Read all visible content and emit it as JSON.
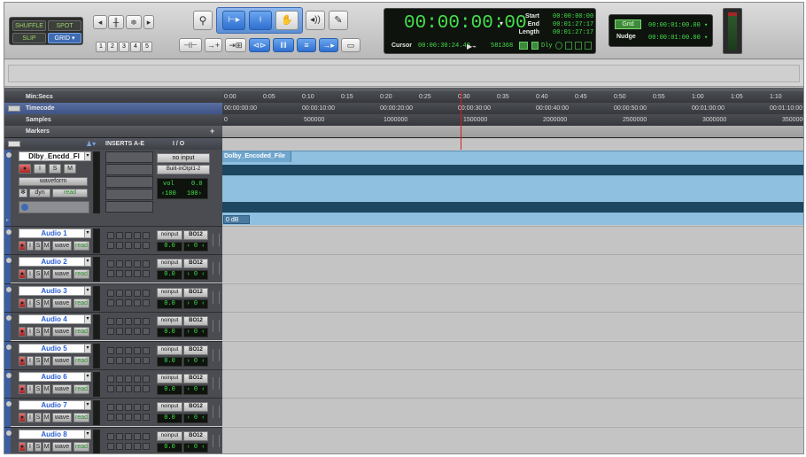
{
  "colors": {
    "accent": "#3f6bb2",
    "counter_green": "#45e04a",
    "track_name": "#2a5fd2",
    "clip_fill": "#8fc0df",
    "clip_dark": "#1d4660",
    "ruler": "#3a3c41",
    "playhead": "#d02020"
  },
  "modes": {
    "shuffle": "SHUFFLE",
    "spot": "SPOT",
    "slip": "SLIP",
    "grid": "GRID ▾"
  },
  "zoom_presets": [
    "1",
    "2",
    "3",
    "4",
    "5"
  ],
  "tool_icons": [
    "zoomer-icon",
    "trim-icon",
    "selector-icon",
    "grabber-icon",
    "scrub-icon",
    "pencil-icon"
  ],
  "counters": {
    "main": "00:00:00:00",
    "main_arrow": "▾",
    "start_label": "Start",
    "end_label": "End",
    "length_label": "Length",
    "start": "00:00:00:00",
    "end": "00:01:27:17",
    "length": "00:01:27:17",
    "cursor_label": "Cursor",
    "cursor": "00:00:30:24.40",
    "sample_count": "581368",
    "dly": "Dly"
  },
  "grid": {
    "grid_label": "Grid",
    "grid_value": "00:00:01:00.00 ▾",
    "nudge_label": "Nudge",
    "nudge_value": "00:00:01:00.00 ▾"
  },
  "rulers": {
    "minsecs": {
      "label": "Min:Secs",
      "ticks": [
        "0:00",
        "0:05",
        "0:10",
        "0:15",
        "0:20",
        "0:25",
        "0:30",
        "0:35",
        "0:40",
        "0:45",
        "0:50",
        "0:55",
        "1:00",
        "1:05",
        "1:10"
      ]
    },
    "timecode": {
      "label": "Timecode",
      "ticks": [
        "00:00:00:00",
        "00:00:10:00",
        "00:00:20:00",
        "00:00:30:00",
        "00:00:40:00",
        "00:00:50:00",
        "00:01:00:00",
        "00:01:10:00"
      ]
    },
    "samples": {
      "label": "Samples",
      "ticks": [
        "0",
        "500000",
        "1000000",
        "1500000",
        "2000000",
        "2500000",
        "3000000",
        "3500000"
      ]
    },
    "markers": {
      "label": "Markers",
      "add": "+"
    }
  },
  "column_headers": {
    "inserts": "INSERTS A-E",
    "io": "I / O"
  },
  "main_track": {
    "name": "Dlby_Encdd_Fl",
    "view": "waveform",
    "automation": "dyn",
    "mode": "read",
    "input": "no input",
    "output": "Built-inOtpt1-2",
    "vol_label": "vol",
    "vol_value": "0.0",
    "pan_left": "‹100",
    "pan_right": "100›",
    "clip_name": "Dolby_Encoded_File",
    "clip_gain": "0 dB"
  },
  "tracks": [
    {
      "name": "Audio 1"
    },
    {
      "name": "Audio 2"
    },
    {
      "name": "Audio 3"
    },
    {
      "name": "Audio 4"
    },
    {
      "name": "Audio 5"
    },
    {
      "name": "Audio 6"
    },
    {
      "name": "Audio 7"
    },
    {
      "name": "Audio 8"
    }
  ],
  "track_common": {
    "i": "I",
    "s": "S",
    "m": "M",
    "wave": "wave",
    "read": "read",
    "input": "noinput",
    "output": "BO12",
    "vol": "0.0",
    "pan": "› 0 ‹"
  }
}
